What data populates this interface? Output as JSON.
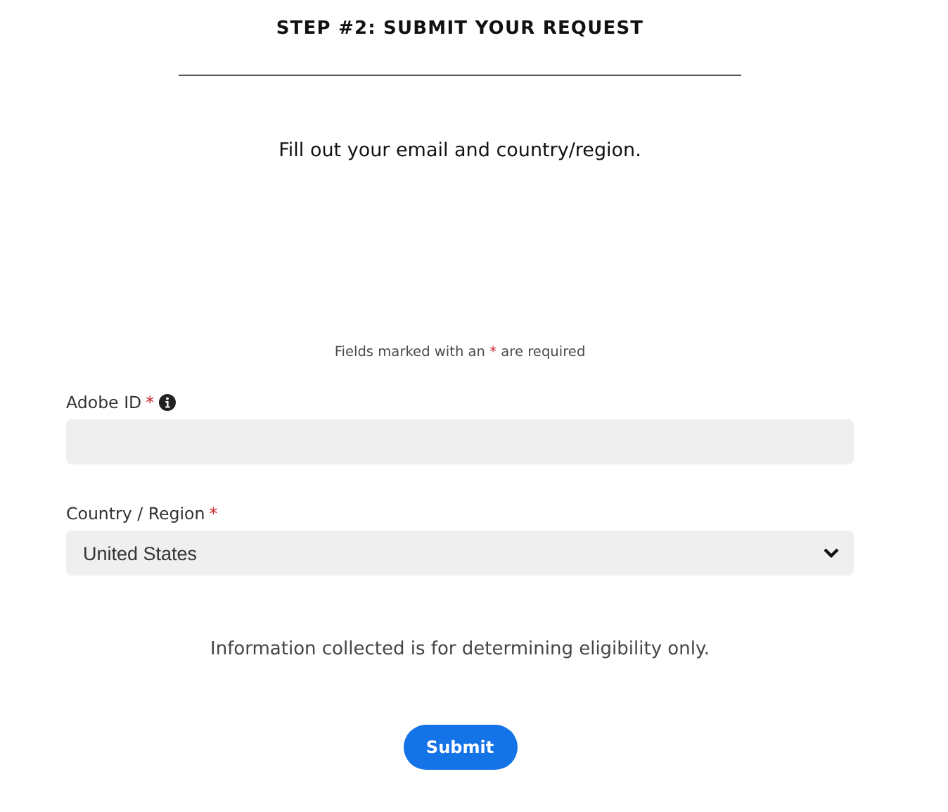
{
  "heading": "STEP #2: SUBMIT YOUR REQUEST",
  "subtitle": "Fill out your email and country/region.",
  "required_note": {
    "before": "Fields marked with an",
    "mark": "*",
    "after": "are required"
  },
  "fields": [
    {
      "kind": "input",
      "label": "Adobe ID",
      "required": true,
      "required_mark": "*",
      "info": true
    },
    {
      "kind": "select",
      "label": "Country / Region",
      "required": true,
      "required_mark": "*",
      "info": false,
      "value": "United States"
    }
  ],
  "disclaimer": "Information collected is for determining eligibility only.",
  "submit": "Submit"
}
